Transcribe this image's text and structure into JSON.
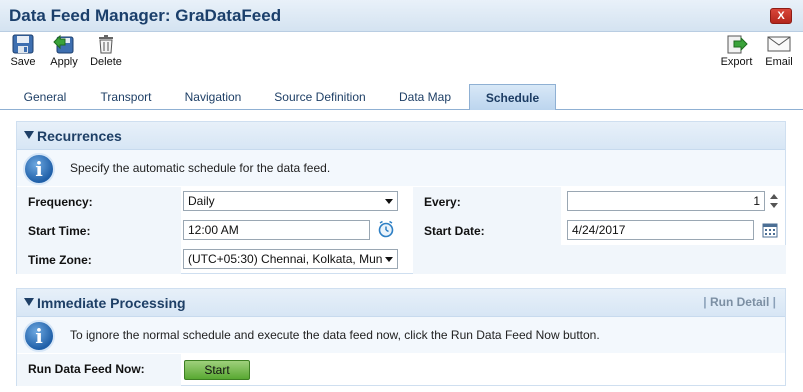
{
  "window": {
    "title": "Data Feed Manager: GraDataFeed",
    "close_label": "X"
  },
  "toolbar": {
    "save_label": "Save",
    "apply_label": "Apply",
    "delete_label": "Delete",
    "export_label": "Export",
    "email_label": "Email"
  },
  "tabs": [
    {
      "label": "General",
      "active": false
    },
    {
      "label": "Transport",
      "active": false
    },
    {
      "label": "Navigation",
      "active": false
    },
    {
      "label": "Source Definition",
      "active": false
    },
    {
      "label": "Data Map",
      "active": false
    },
    {
      "label": "Schedule",
      "active": true
    }
  ],
  "recurrences": {
    "title": "Recurrences",
    "info_text": "Specify the automatic schedule for the data feed.",
    "frequency": {
      "label": "Frequency:",
      "value": "Daily"
    },
    "every": {
      "label": "Every:",
      "value": "1"
    },
    "start_time": {
      "label": "Start Time:",
      "value": "12:00 AM"
    },
    "start_date": {
      "label": "Start Date:",
      "value": "4/24/2017"
    },
    "time_zone": {
      "label": "Time Zone:",
      "value": "(UTC+05:30) Chennai, Kolkata, Mun"
    }
  },
  "immediate": {
    "title": "Immediate Processing",
    "run_detail_label": "Run Detail",
    "info_text": "To ignore the normal schedule and execute the data feed now, click the Run Data Feed Now button.",
    "run_now_label": "Run Data Feed Now:",
    "start_button_label": "Start"
  },
  "colors": {
    "accent": "#1e3f66",
    "header_bg": "#d7e6f5",
    "start_button": "#58a832",
    "close_button": "#c2332a"
  }
}
